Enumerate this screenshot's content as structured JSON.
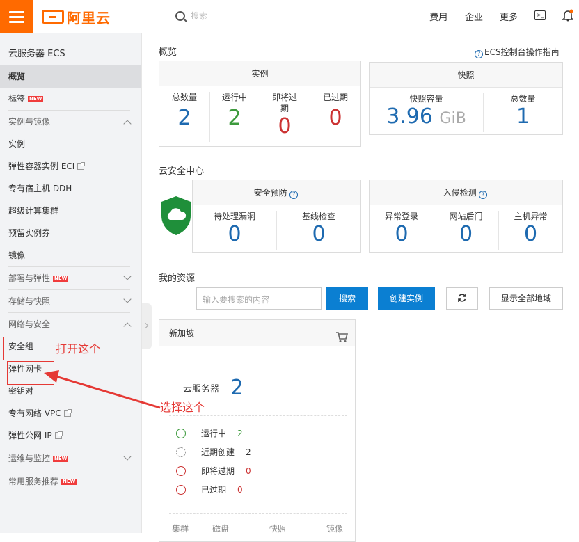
{
  "topbar": {
    "logo": "阿里云",
    "search_placeholder": "搜索",
    "nav": [
      "费用",
      "企业",
      "更多"
    ]
  },
  "sidebar": {
    "title": "云服务器 ECS",
    "overview": "概览",
    "tags": "标签",
    "new_badge": "NEW",
    "group_instances": "实例与镜像",
    "instances": "实例",
    "eci": "弹性容器实例 ECI",
    "ddh": "专有宿主机 DDH",
    "supercompute": "超级计算集群",
    "reserved": "预留实例券",
    "images": "镜像",
    "group_deploy": "部署与弹性",
    "group_storage": "存储与快照",
    "group_network": "网络与安全",
    "security_group": "安全组",
    "eni": "弹性网卡",
    "keypair": "密钥对",
    "vpc": "专有网络 VPC",
    "eip": "弹性公网 IP",
    "group_ops": "运维与监控",
    "group_common": "常用服务推荐"
  },
  "overview": {
    "title": "概览",
    "guide": "ECS控制台操作指南"
  },
  "instances_box": {
    "header": "实例",
    "total_label": "总数量",
    "total": "2",
    "running_label": "运行中",
    "running": "2",
    "expiring_label": "即将过期",
    "expiring": "0",
    "expired_label": "已过期",
    "expired": "0"
  },
  "snapshot_box": {
    "header": "快照",
    "capacity_label": "快照容量",
    "capacity": "3.96",
    "capacity_unit": "GiB",
    "total_label": "总数量",
    "total": "1"
  },
  "security_center": {
    "title": "云安全中心",
    "prevention_header": "安全预防",
    "vuln_label": "待处理漏洞",
    "vuln": "0",
    "baseline_label": "基线检查",
    "baseline": "0",
    "intrusion_header": "入侵检测",
    "login_label": "异常登录",
    "login": "0",
    "backdoor_label": "网站后门",
    "backdoor": "0",
    "host_label": "主机异常",
    "host": "0"
  },
  "resources": {
    "title": "我的资源",
    "search_placeholder": "输入要搜索的内容",
    "search_btn": "搜索",
    "create_btn": "创建实例",
    "all_regions_btn": "显示全部地域"
  },
  "region": {
    "name": "新加坡",
    "server_label": "云服务器",
    "server_count": "2",
    "running_label": "运行中",
    "running": "2",
    "recent_label": "近期创建",
    "recent": "2",
    "expiring_label": "即将过期",
    "expiring": "0",
    "expired_label": "已过期",
    "expired": "0",
    "footer": [
      "集群",
      "磁盘",
      "快照",
      "镜像"
    ]
  },
  "annotations": {
    "open_this": "打开这个",
    "select_this": "选择这个"
  },
  "colors": {
    "brand": "#ff6a00",
    "primary": "#0b7fd2",
    "annotation": "#e53935"
  }
}
